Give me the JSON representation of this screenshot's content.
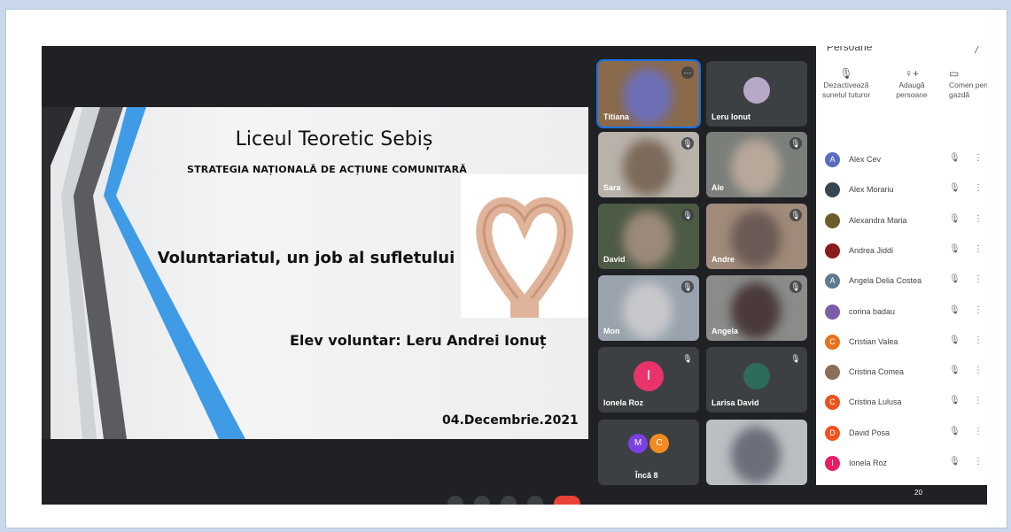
{
  "slide": {
    "title": "Liceul Teoretic Sebiș",
    "subtitle": "STRATEGIA NAȚIONALĂ DE ACȚIUNE COMUNITARĂ",
    "main": "Voluntariatul, un job al sufletului",
    "student": "Elev voluntar: Leru Andrei Ionuț",
    "date": "04.Decembrie.2021"
  },
  "tiles": [
    {
      "label": "Titiana"
    },
    {
      "label": "Leru Ionut"
    },
    {
      "label": "Sara"
    },
    {
      "label": "Ale"
    },
    {
      "label": "David"
    },
    {
      "label": "Andre"
    },
    {
      "label": "Mon"
    },
    {
      "label": "Angela"
    },
    {
      "label": "Ionela Roz",
      "initial": "I"
    },
    {
      "label": "Larisa David"
    },
    {
      "label": "Încă 8",
      "initials": [
        "M",
        "C"
      ]
    },
    {
      "label": ""
    }
  ],
  "panel": {
    "title": "Persoane",
    "actions": [
      {
        "label": "Dezactivează sunetul tuturor",
        "icon": "mic-off-icon"
      },
      {
        "label": "Adaugă persoane",
        "icon": "add-person-icon"
      },
      {
        "label": "Comen pentr gazdă",
        "icon": "host-controls-icon"
      }
    ],
    "people": [
      {
        "name": "Alex Cev",
        "initial": "A",
        "color": "#5c6bc0"
      },
      {
        "name": "Alex Morariu",
        "initial": "",
        "color": "#37474f"
      },
      {
        "name": "Alexandra Maria",
        "initial": "",
        "color": "#6d5d2c"
      },
      {
        "name": "Andrea Jiddi",
        "initial": "",
        "color": "#8b1a1a"
      },
      {
        "name": "Angela Delia Costea",
        "initial": "A",
        "color": "#5f7a91"
      },
      {
        "name": "corina badau",
        "initial": "",
        "color": "#7b5ea7"
      },
      {
        "name": "Cristian Valea",
        "initial": "C",
        "color": "#e8711c"
      },
      {
        "name": "Cristina Comea",
        "initial": "",
        "color": "#8a6e5a"
      },
      {
        "name": "Cristina Lulusa",
        "initial": "C",
        "color": "#e8541c"
      },
      {
        "name": "David Posa",
        "initial": "D",
        "color": "#f4511e"
      },
      {
        "name": "Ionela Roz",
        "initial": "I",
        "color": "#e91e63"
      }
    ],
    "count_badge": "20"
  }
}
